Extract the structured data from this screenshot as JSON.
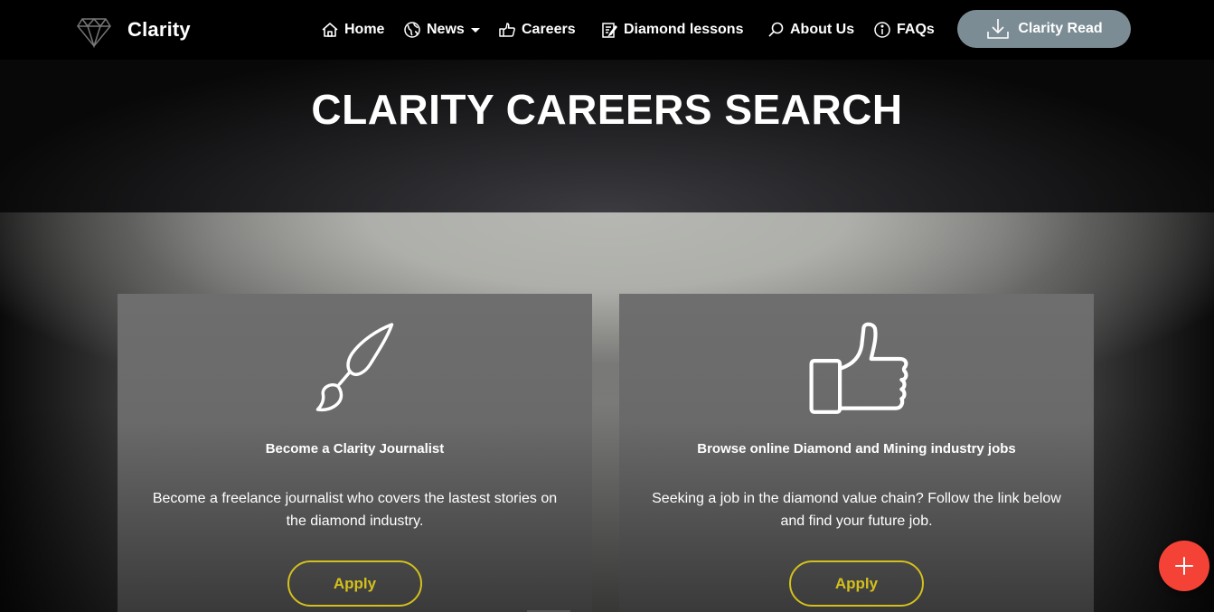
{
  "brand": {
    "name": "Clarity",
    "logo_icon": "diamond-icon"
  },
  "nav": {
    "items": [
      {
        "label": "Home",
        "icon": "home-icon"
      },
      {
        "label": "News",
        "icon": "globe-icon",
        "has_dropdown": true
      },
      {
        "label": "Careers",
        "icon": "thumbs-up-icon"
      },
      {
        "label": "Diamond lessons",
        "icon": "edit-icon"
      },
      {
        "label": "About Us",
        "icon": "search-icon"
      },
      {
        "label": "FAQs",
        "icon": "info-icon"
      }
    ],
    "cta": {
      "label": "Clarity Read",
      "icon": "download-icon",
      "color": "#7b8c94"
    }
  },
  "hero": {
    "title": "CLARITY CAREERS SEARCH"
  },
  "cards": [
    {
      "icon": "paintbrush-icon",
      "title": "Become a Clarity Journalist",
      "description": "Become a freelance journalist who covers the lastest stories on the diamond industry.",
      "button_label": "Apply"
    },
    {
      "icon": "thumbs-up-icon",
      "title": "Browse online Diamond and Mining industry jobs",
      "description": "Seeking a job in the diamond value chain? Follow the link below and find your future job.",
      "button_label": "Apply"
    }
  ],
  "fab": {
    "icon": "plus-icon",
    "color": "#f44336"
  },
  "colors": {
    "accent": "#d4c01c",
    "header_bg": "#000000"
  }
}
